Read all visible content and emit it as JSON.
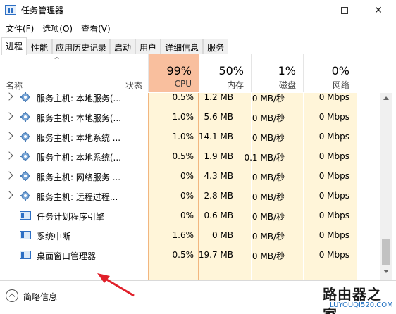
{
  "window": {
    "title": "任务管理器",
    "min_icon": "minimize-icon",
    "max_icon": "maximize-icon",
    "close_glyph": "✕"
  },
  "menu": [
    "文件(F)",
    "选项(O)",
    "查看(V)"
  ],
  "tabs": [
    {
      "label": "进程",
      "active": true
    },
    {
      "label": "性能",
      "active": false
    },
    {
      "label": "应用历史记录",
      "active": false
    },
    {
      "label": "启动",
      "active": false
    },
    {
      "label": "用户",
      "active": false
    },
    {
      "label": "详细信息",
      "active": false
    },
    {
      "label": "服务",
      "active": false
    }
  ],
  "columns": {
    "name": "名称",
    "status": "状态",
    "cpu": {
      "pct": "99%",
      "label": "CPU"
    },
    "memory": {
      "pct": "50%",
      "label": "内存"
    },
    "disk": {
      "pct": "1%",
      "label": "磁盘"
    },
    "network": {
      "pct": "0%",
      "label": "网络"
    }
  },
  "rows": [
    {
      "name": "服务主机: 本地服务(...",
      "icon": "gear-icon",
      "expandable": true,
      "cpu": "0.5%",
      "memory": "1.2 MB",
      "disk": "0 MB/秒",
      "network": "0 Mbps"
    },
    {
      "name": "服务主机: 本地服务(...",
      "icon": "gear-icon",
      "expandable": true,
      "cpu": "1.0%",
      "memory": "5.6 MB",
      "disk": "0 MB/秒",
      "network": "0 Mbps"
    },
    {
      "name": "服务主机: 本地系统 ...",
      "icon": "gear-icon",
      "expandable": true,
      "cpu": "1.0%",
      "memory": "14.1 MB",
      "disk": "0 MB/秒",
      "network": "0 Mbps"
    },
    {
      "name": "服务主机: 本地系统(...",
      "icon": "gear-icon",
      "expandable": true,
      "cpu": "0.5%",
      "memory": "1.9 MB",
      "disk": "0.1 MB/秒",
      "network": "0 Mbps"
    },
    {
      "name": "服务主机: 网络服务 ...",
      "icon": "gear-icon",
      "expandable": true,
      "cpu": "0%",
      "memory": "4.3 MB",
      "disk": "0 MB/秒",
      "network": "0 Mbps"
    },
    {
      "name": "服务主机: 远程过程...",
      "icon": "gear-icon",
      "expandable": true,
      "cpu": "0%",
      "memory": "2.8 MB",
      "disk": "0 MB/秒",
      "network": "0 Mbps"
    },
    {
      "name": "任务计划程序引擎",
      "icon": "window-icon",
      "expandable": false,
      "cpu": "0%",
      "memory": "0.6 MB",
      "disk": "0 MB/秒",
      "network": "0 Mbps"
    },
    {
      "name": "系统中断",
      "icon": "window-icon",
      "expandable": false,
      "cpu": "1.6%",
      "memory": "0 MB",
      "disk": "0 MB/秒",
      "network": "0 Mbps"
    },
    {
      "name": "桌面窗口管理器",
      "icon": "window-icon",
      "expandable": false,
      "cpu": "0.5%",
      "memory": "19.7 MB",
      "disk": "0 MB/秒",
      "network": "0 Mbps"
    }
  ],
  "footer": {
    "label": "简略信息"
  },
  "watermark": {
    "title": "路由器之家",
    "sub": "LUYOUQI520.COM"
  },
  "colors": {
    "cpu_header": "#f9bf9e",
    "cpu_cell": "#fff5d9",
    "cell": "#fff5d9",
    "accent": "#2d6fc4",
    "arrow": "#e0202a"
  }
}
